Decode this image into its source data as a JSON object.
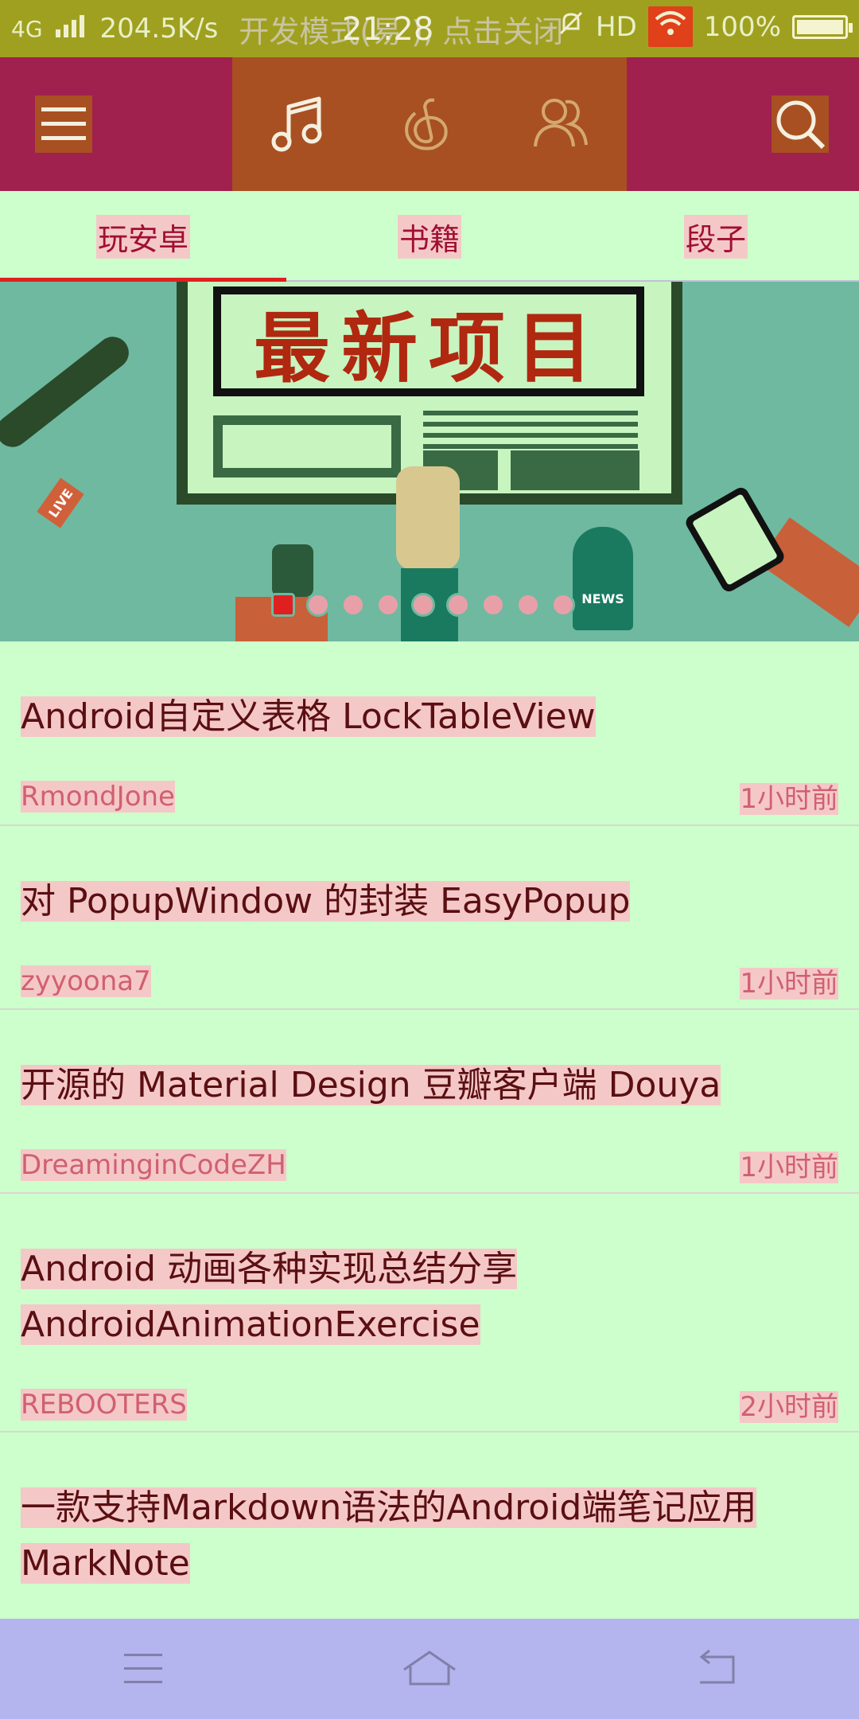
{
  "status_bar": {
    "network": "4G",
    "speed": "204.5K/s",
    "developer_mode": "开发模式(易  ), 点击关闭",
    "time": "21:28",
    "hd": "HD",
    "battery": "100%"
  },
  "app_bar": {
    "menu_icon": "menu-icon",
    "tab_icons": [
      "music-icon",
      "netease-cloud-icon",
      "friends-icon"
    ],
    "search_icon": "search-icon"
  },
  "tabs": [
    {
      "label": "玩安卓",
      "active": true
    },
    {
      "label": "书籍",
      "active": false
    },
    {
      "label": "段子",
      "active": false
    }
  ],
  "banner": {
    "headline": "最新项目",
    "live_tag": "LIVE",
    "news_tag": "NEWS",
    "dot_count": 9,
    "active_dot": 0
  },
  "articles": [
    {
      "title": "Android自定义表格 LockTableView",
      "author": "RmondJone",
      "time": "1小时前"
    },
    {
      "title": "对 PopupWindow 的封装 EasyPopup",
      "author": "zyyoona7",
      "time": "1小时前"
    },
    {
      "title": "开源的 Material Design 豆瓣客户端 Douya",
      "author": "DreaminginCodeZH",
      "time": "1小时前"
    },
    {
      "title": "Android 动画各种实现总结分享 AndroidAnimationExercise",
      "author": "REBOOTERS",
      "time": "2小时前"
    },
    {
      "title": "一款支持Markdown语法的Android端笔记应用 MarkNote",
      "author": "",
      "time": ""
    }
  ],
  "nav_bar": {
    "icons": [
      "recent-apps-icon",
      "home-icon",
      "back-icon"
    ]
  },
  "colors": {
    "app_bar": "#a0204e",
    "app_bar_center": "#a85022",
    "background": "#ccffcc",
    "accent": "#e02020",
    "nav_bar": "#b4b4ee"
  }
}
